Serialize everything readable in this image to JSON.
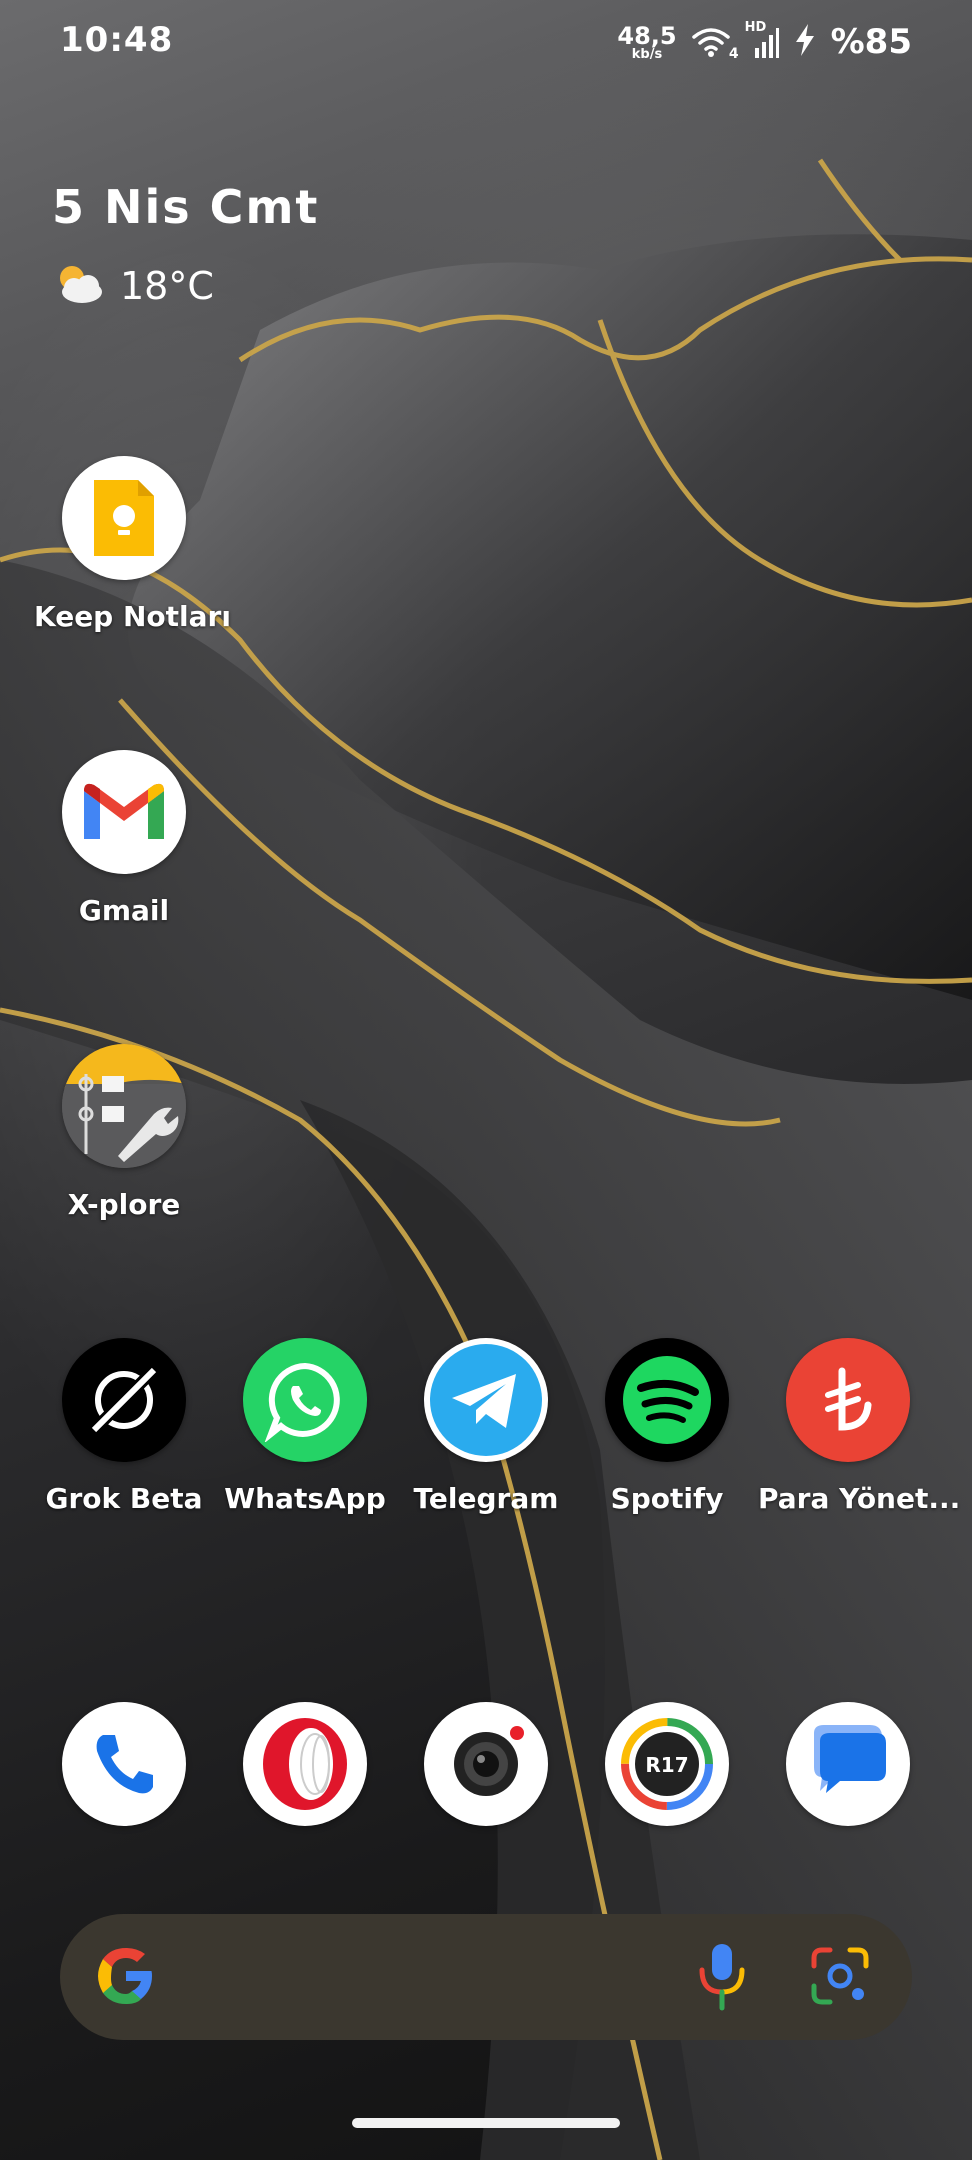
{
  "status_bar": {
    "time": "10:48",
    "net_speed_value": "48,5",
    "net_speed_unit": "kb/s",
    "wifi_badge": "4",
    "signal_badge": "HD",
    "battery": "%85"
  },
  "widget": {
    "date": "5 Nis Cmt",
    "weather_icon": "partly-cloudy-icon",
    "temperature": "18°C"
  },
  "apps_column": [
    {
      "label": "Keep Notları",
      "icon": "keep-notes-icon"
    },
    {
      "label": "Gmail",
      "icon": "gmail-icon"
    },
    {
      "label": "X-plore",
      "icon": "xplore-icon"
    }
  ],
  "apps_row": [
    {
      "label": "Grok Beta",
      "icon": "grok-icon"
    },
    {
      "label": "WhatsApp",
      "icon": "whatsapp-icon"
    },
    {
      "label": "Telegram",
      "icon": "telegram-icon"
    },
    {
      "label": "Spotify",
      "icon": "spotify-icon"
    },
    {
      "label": "Para Yönet...",
      "icon": "lira-icon"
    }
  ],
  "dock": [
    {
      "icon": "phone-icon"
    },
    {
      "icon": "opera-icon"
    },
    {
      "icon": "camera-icon"
    },
    {
      "icon": "r17-icon",
      "text": "R17"
    },
    {
      "icon": "messages-icon"
    }
  ],
  "colors": {
    "keep": "#FBBC04",
    "whatsapp": "#25D366",
    "telegram": "#2AABEE",
    "spotify": "#1ED760",
    "para": "#EA4335",
    "search_bar": "#3b372f"
  }
}
